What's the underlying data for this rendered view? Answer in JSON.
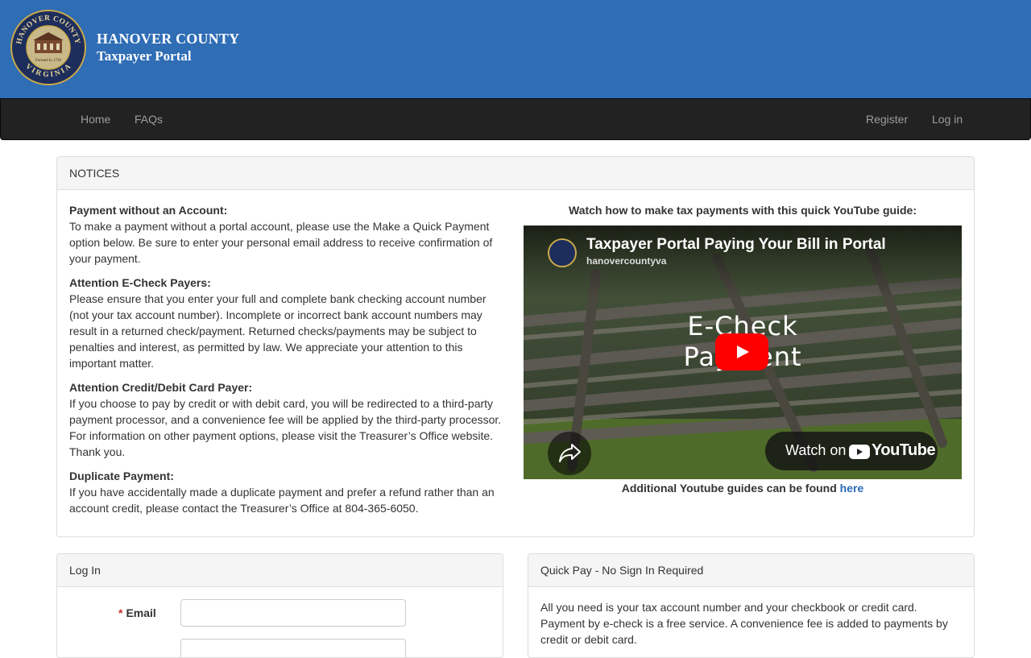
{
  "header": {
    "title_line1": "HANOVER COUNTY",
    "title_line2": "Taxpayer Portal",
    "seal": {
      "top_text": "HANOVER COUNTY",
      "bottom_text": "VIRGINIA",
      "inner_text": "Formed in 1720",
      "icon": "county-seal-courthouse"
    }
  },
  "nav": {
    "home": "Home",
    "faqs": "FAQs",
    "register": "Register",
    "login": "Log in"
  },
  "notices": {
    "heading": "NOTICES",
    "items": [
      {
        "title": "Payment without an Account:",
        "body": "To make a payment without a portal account, please use the Make a Quick Payment option below. Be sure to enter your personal email address to receive confirmation of your payment."
      },
      {
        "title": "Attention E-Check Payers:",
        "body": "Please ensure that you enter your full and complete bank checking account number (not your tax account number). Incomplete or incorrect bank account numbers may result in a returned check/payment. Returned checks/payments may be subject to penalties and interest, as permitted by law. We appreciate your attention to this important matter."
      },
      {
        "title": "Attention Credit/Debit Card Payer:",
        "body": "If you choose to pay by credit or with debit card, you will be redirected to a third-party payment processor, and a convenience fee will be applied by the third-party processor. For information on other payment options, please visit the Treasurer’s Office website. Thank you."
      },
      {
        "title": "Duplicate Payment:",
        "body": "If you have accidentally made a duplicate payment and prefer a refund rather than an account credit, please contact the Treasurer’s Office at 804-365-6050."
      }
    ],
    "video": {
      "caption": "Watch how to make tax payments with this quick YouTube guide:",
      "title": "Taxpayer Portal Paying Your Bill in Portal",
      "channel": "hanovercountyva",
      "overlay_line1": "E-Check",
      "overlay_line2": "Payment",
      "watch_on": "Watch on",
      "youtube": "YouTube"
    },
    "more_guides_text": "Additional Youtube guides can be found ",
    "more_guides_link": "here"
  },
  "login": {
    "heading": "Log In",
    "email_label": "Email",
    "email_value": "",
    "password_value": ""
  },
  "quickpay": {
    "heading": "Quick Pay - No Sign In Required",
    "text": "All you need is your tax account number and your checkbook or credit card. Payment by e-check is a free service. A convenience fee is added to payments by credit or debit card."
  },
  "colors": {
    "banner": "#2f6db5",
    "navbar": "#222222",
    "link": "#2a6ab4",
    "youtube_red": "#ff0000"
  }
}
